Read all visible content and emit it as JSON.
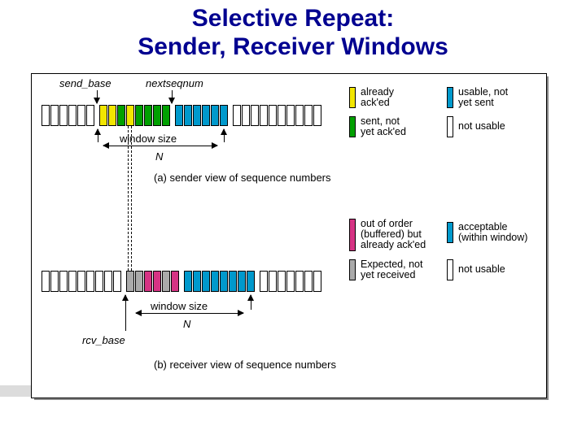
{
  "title_line1": "Selective Repeat:",
  "title_line2": "Sender, Receiver Windows",
  "sender": {
    "send_base": "send_base",
    "nextseqnum": "nextseqnum",
    "window_size": "window size",
    "N": "N",
    "caption": "(a) sender view of sequence numbers",
    "legend": {
      "already_acked": "already\nack'ed",
      "sent_not_acked": "sent, not\nyet ack'ed",
      "usable_not_sent": "usable, not\nyet sent",
      "not_usable": "not usable"
    }
  },
  "receiver": {
    "rcv_base": "rcv_base",
    "window_size": "window size",
    "N": "N",
    "caption": "(b) receiver view of sequence numbers",
    "legend": {
      "out_of_order": "out of order\n(buffered) but\nalready ack'ed",
      "expected": "Expected, not\nyet received",
      "acceptable": "acceptable\n(within window)",
      "not_usable": "not usable"
    }
  },
  "colors": {
    "yellow": "#f2e600",
    "green": "#00a000",
    "blue": "#0099cc",
    "pink": "#d63384",
    "gray": "#aaaaaa"
  }
}
